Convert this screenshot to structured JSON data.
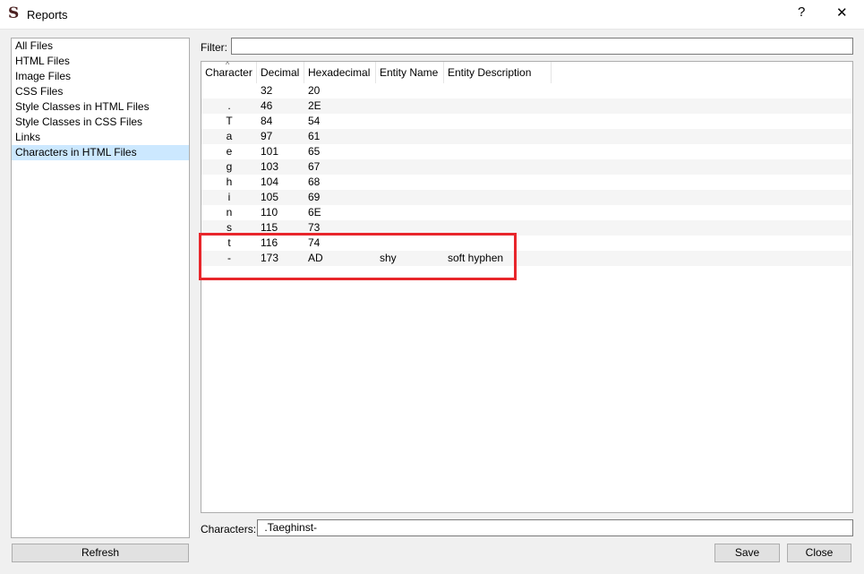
{
  "window": {
    "title": "Reports",
    "logo": "S",
    "help": "?",
    "close": "✕"
  },
  "sidebar": {
    "items": [
      {
        "label": "All Files"
      },
      {
        "label": "HTML Files"
      },
      {
        "label": "Image Files"
      },
      {
        "label": "CSS Files"
      },
      {
        "label": "Style Classes in HTML Files"
      },
      {
        "label": "Style Classes in CSS Files"
      },
      {
        "label": "Links"
      },
      {
        "label": "Characters in HTML Files",
        "selected": true
      }
    ]
  },
  "filter": {
    "label": "Filter:",
    "value": ""
  },
  "table": {
    "columns": [
      "Character",
      "Decimal",
      "Hexadecimal",
      "Entity Name",
      "Entity Description"
    ],
    "rows": [
      [
        "",
        "32",
        "20",
        "",
        ""
      ],
      [
        ".",
        "46",
        "2E",
        "",
        ""
      ],
      [
        "T",
        "84",
        "54",
        "",
        ""
      ],
      [
        "a",
        "97",
        "61",
        "",
        ""
      ],
      [
        "e",
        "101",
        "65",
        "",
        ""
      ],
      [
        "g",
        "103",
        "67",
        "",
        ""
      ],
      [
        "h",
        "104",
        "68",
        "",
        ""
      ],
      [
        "i",
        "105",
        "69",
        "",
        ""
      ],
      [
        "n",
        "110",
        "6E",
        "",
        ""
      ],
      [
        "s",
        "115",
        "73",
        "",
        ""
      ],
      [
        "t",
        "116",
        "74",
        "",
        ""
      ],
      [
        "-",
        "173",
        "AD",
        "shy",
        "soft hyphen"
      ]
    ]
  },
  "characters": {
    "label": "Characters:",
    "value": " .Taeghinst-"
  },
  "buttons": {
    "refresh": "Refresh",
    "save": "Save",
    "close": "Close"
  },
  "highlight_color": "#e8262b"
}
